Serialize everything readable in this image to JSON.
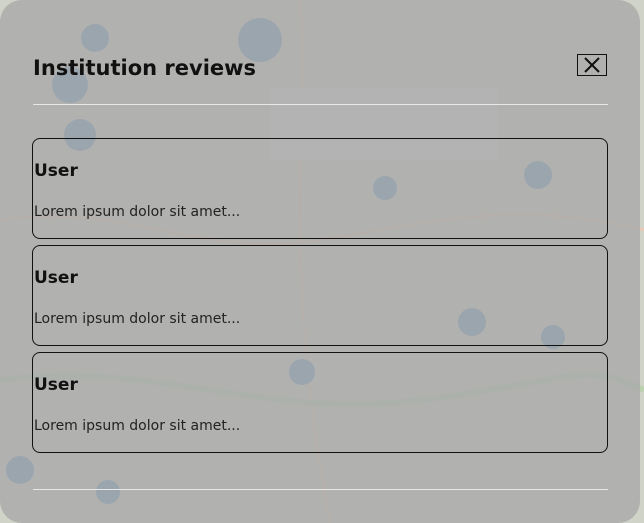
{
  "modal": {
    "title": "Institution reviews",
    "close_icon": "close-x-icon"
  },
  "reviews": [
    {
      "user": "User",
      "text": "Lorem ipsum dolor sit amet..."
    },
    {
      "user": "User",
      "text": "Lorem ipsum dolor sit amet..."
    },
    {
      "user": "User",
      "text": "Lorem ipsum dolor sit amet..."
    }
  ],
  "colors": {
    "overlay": "#aaaaaa",
    "text": "#111111",
    "map_base": "#cfd3c8",
    "marker": "#5b8fc4"
  }
}
